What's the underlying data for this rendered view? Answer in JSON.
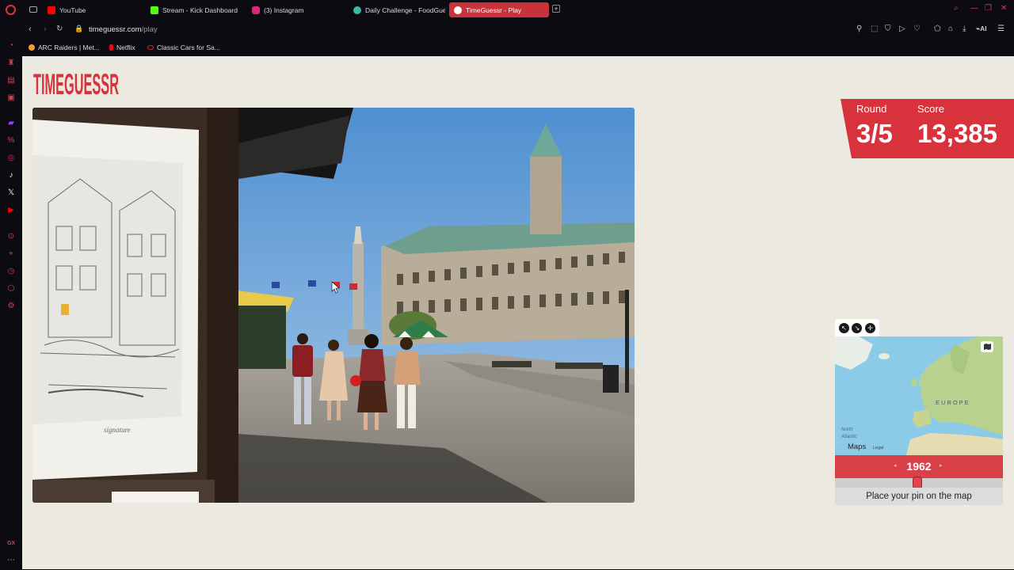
{
  "browser": {
    "tabs": [
      {
        "label": "YouTube",
        "color": "#ff0000"
      },
      {
        "label": "Stream - Kick Dashboard",
        "color": "#53fc18"
      },
      {
        "label": "(3) Instagram",
        "color": "#d62976"
      },
      {
        "label": "Daily Challenge - FoodGuessr",
        "color": "#3db8a0"
      },
      {
        "label": "TimeGuessr - Play",
        "color": "#ffffff"
      }
    ],
    "address": {
      "domain": "timeguessr.com",
      "path": "/play"
    },
    "bookmarks": [
      {
        "label": "ARC Raiders | Met...",
        "color": "#f0a030"
      },
      {
        "label": "Netflix",
        "color": "#e50914"
      },
      {
        "label": "Classic Cars for Sa...",
        "color": "#c03030"
      }
    ],
    "toolbar_ai_label": "AI",
    "sidebar_bottom_label": "GX"
  },
  "game": {
    "logo_text": "TIMEGUESSR",
    "round_label": "Round",
    "round_value": "3/5",
    "score_label": "Score",
    "score_value": "13,385",
    "year": "1962",
    "year_slider_fraction": 0.49,
    "pin_prompt": "Place your pin on the map",
    "map": {
      "labels": {
        "europe": "EUROPE",
        "atlantic_1": "North",
        "atlantic_2": "Atlantic",
        "maps_brand": "Maps",
        "legal": "Legal"
      }
    },
    "photo_flags": [
      "🇫🇷",
      "🇨🇦"
    ]
  },
  "colors": {
    "accent": "#d94048",
    "page_bg": "#ebe9e0",
    "browser_bg": "#0d0b12"
  }
}
